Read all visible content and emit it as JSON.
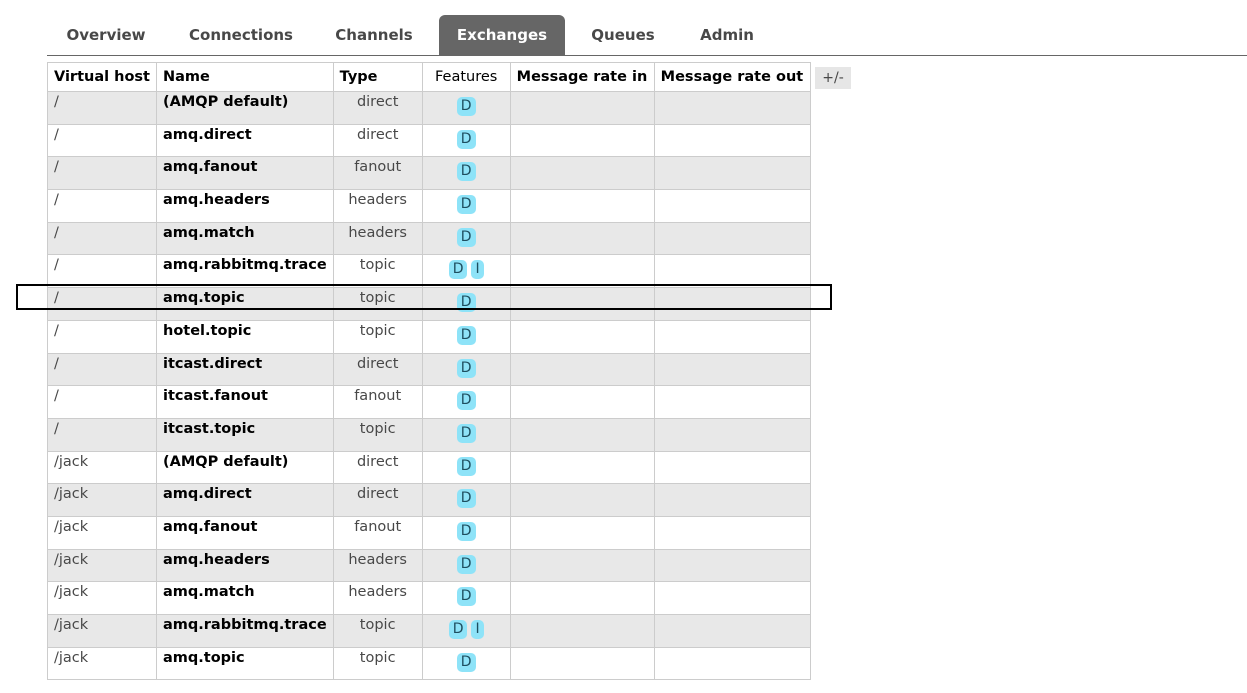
{
  "nav": {
    "tabs": [
      {
        "label": "Overview"
      },
      {
        "label": "Connections"
      },
      {
        "label": "Channels"
      },
      {
        "label": "Exchanges"
      },
      {
        "label": "Queues"
      },
      {
        "label": "Admin"
      }
    ],
    "active_tab": "Exchanges"
  },
  "table": {
    "headers": {
      "vhost": "Virtual host",
      "name": "Name",
      "type": "Type",
      "features": "Features",
      "rate_in": "Message rate in",
      "rate_out": "Message rate out"
    },
    "toggle_columns": "+/-",
    "rows": [
      {
        "vhost": "/",
        "name": "(AMQP default)",
        "type": "direct",
        "features": [
          "D"
        ],
        "rate_in": "",
        "rate_out": ""
      },
      {
        "vhost": "/",
        "name": "amq.direct",
        "type": "direct",
        "features": [
          "D"
        ],
        "rate_in": "",
        "rate_out": ""
      },
      {
        "vhost": "/",
        "name": "amq.fanout",
        "type": "fanout",
        "features": [
          "D"
        ],
        "rate_in": "",
        "rate_out": ""
      },
      {
        "vhost": "/",
        "name": "amq.headers",
        "type": "headers",
        "features": [
          "D"
        ],
        "rate_in": "",
        "rate_out": ""
      },
      {
        "vhost": "/",
        "name": "amq.match",
        "type": "headers",
        "features": [
          "D"
        ],
        "rate_in": "",
        "rate_out": ""
      },
      {
        "vhost": "/",
        "name": "amq.rabbitmq.trace",
        "type": "topic",
        "features": [
          "D",
          "I"
        ],
        "rate_in": "",
        "rate_out": ""
      },
      {
        "vhost": "/",
        "name": "amq.topic",
        "type": "topic",
        "features": [
          "D"
        ],
        "rate_in": "",
        "rate_out": "",
        "highlighted": true
      },
      {
        "vhost": "/",
        "name": "hotel.topic",
        "type": "topic",
        "features": [
          "D"
        ],
        "rate_in": "",
        "rate_out": ""
      },
      {
        "vhost": "/",
        "name": "itcast.direct",
        "type": "direct",
        "features": [
          "D"
        ],
        "rate_in": "",
        "rate_out": ""
      },
      {
        "vhost": "/",
        "name": "itcast.fanout",
        "type": "fanout",
        "features": [
          "D"
        ],
        "rate_in": "",
        "rate_out": ""
      },
      {
        "vhost": "/",
        "name": "itcast.topic",
        "type": "topic",
        "features": [
          "D"
        ],
        "rate_in": "",
        "rate_out": ""
      },
      {
        "vhost": "/jack",
        "name": "(AMQP default)",
        "type": "direct",
        "features": [
          "D"
        ],
        "rate_in": "",
        "rate_out": ""
      },
      {
        "vhost": "/jack",
        "name": "amq.direct",
        "type": "direct",
        "features": [
          "D"
        ],
        "rate_in": "",
        "rate_out": ""
      },
      {
        "vhost": "/jack",
        "name": "amq.fanout",
        "type": "fanout",
        "features": [
          "D"
        ],
        "rate_in": "",
        "rate_out": ""
      },
      {
        "vhost": "/jack",
        "name": "amq.headers",
        "type": "headers",
        "features": [
          "D"
        ],
        "rate_in": "",
        "rate_out": ""
      },
      {
        "vhost": "/jack",
        "name": "amq.match",
        "type": "headers",
        "features": [
          "D"
        ],
        "rate_in": "",
        "rate_out": ""
      },
      {
        "vhost": "/jack",
        "name": "amq.rabbitmq.trace",
        "type": "topic",
        "features": [
          "D",
          "I"
        ],
        "rate_in": "",
        "rate_out": ""
      },
      {
        "vhost": "/jack",
        "name": "amq.topic",
        "type": "topic",
        "features": [
          "D"
        ],
        "rate_in": "",
        "rate_out": ""
      }
    ]
  },
  "colors": {
    "active_tab_bg": "#666666",
    "badge_bg": "#8ee3f8",
    "row_alt_bg": "#e8e8e8",
    "highlight_border": "#000000"
  }
}
